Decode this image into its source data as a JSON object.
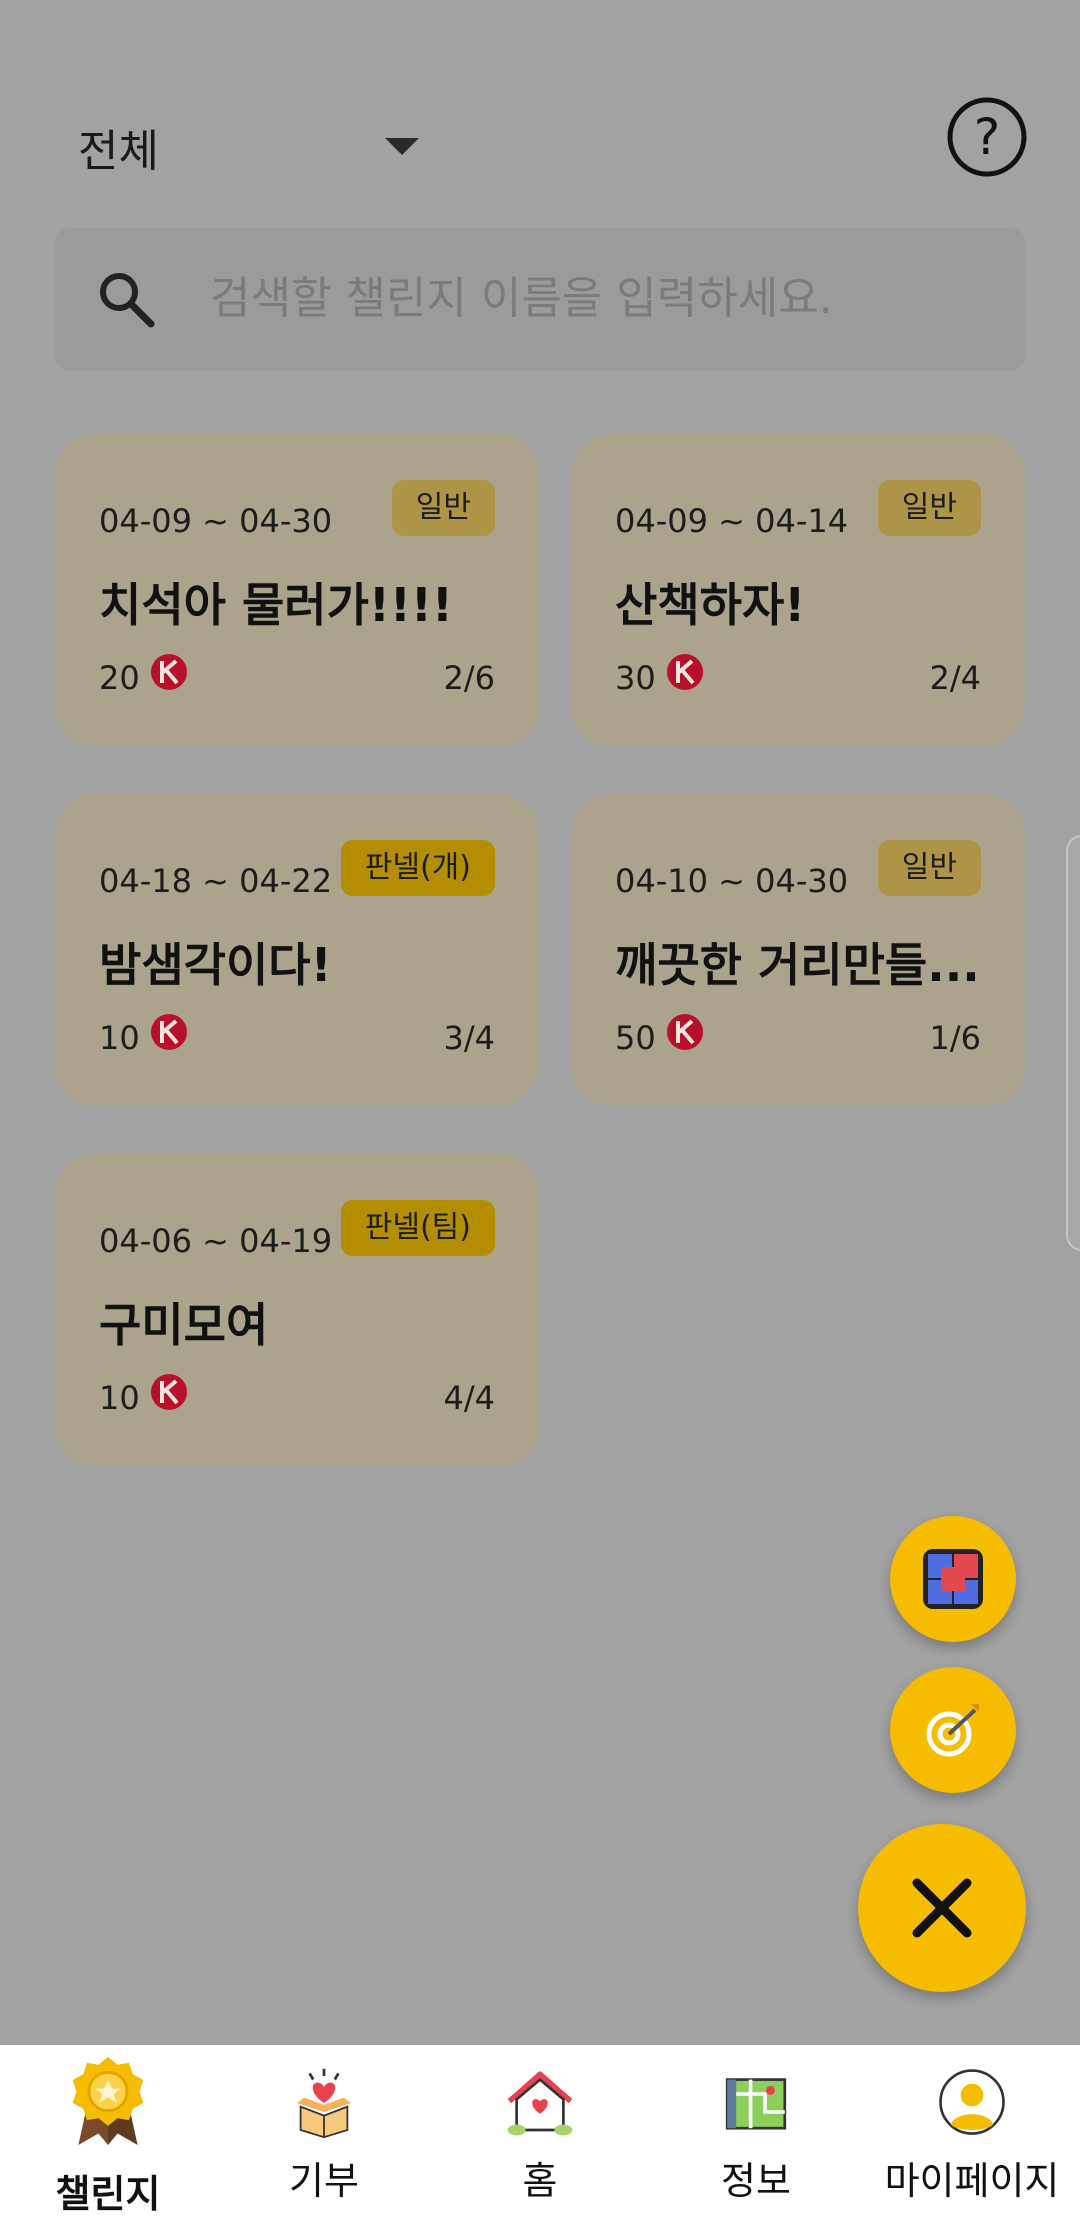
{
  "header": {
    "filter_value": "전체"
  },
  "search": {
    "placeholder": "검색할 챌린지 이름을 입력하세요."
  },
  "challenges": [
    {
      "period": "04-09 ~ 04-30",
      "tag": "일반",
      "title": "치석아 물러가!!!!",
      "points": "20",
      "progress": "2/6"
    },
    {
      "period": "04-09 ~ 04-14",
      "tag": "일반",
      "title": "산책하자!",
      "points": "30",
      "progress": "2/4"
    },
    {
      "period": "04-18 ~ 04-22",
      "tag": "판넬(개)",
      "title": "밤샘각이다!",
      "points": "10",
      "progress": "3/4"
    },
    {
      "period": "04-10 ~ 04-30",
      "tag": "일반",
      "title": "깨끗한 거리만들...",
      "points": "50",
      "progress": "1/6"
    },
    {
      "period": "04-06 ~ 04-19",
      "tag": "판넬(팀)",
      "title": "구미모여",
      "points": "10",
      "progress": "4/4"
    }
  ],
  "nav": {
    "items": [
      {
        "label": "챌린지",
        "icon": "medal-icon"
      },
      {
        "label": "기부",
        "icon": "donation-box-icon"
      },
      {
        "label": "홈",
        "icon": "house-heart-icon"
      },
      {
        "label": "정보",
        "icon": "map-icon"
      },
      {
        "label": "마이페이지",
        "icon": "user-avatar-icon"
      }
    ],
    "active": "챌린지"
  },
  "colors": {
    "accent": "#f5bc00",
    "card": "#aba38c",
    "overlay": "#a3a2a3"
  }
}
